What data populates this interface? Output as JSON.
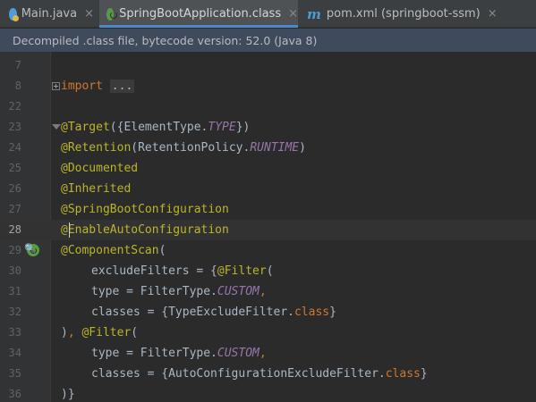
{
  "tabs": [
    {
      "label": "Main.java",
      "icon": "java-class-icon",
      "active": false
    },
    {
      "label": "SpringBootApplication.class",
      "icon": "spring-icon",
      "active": true
    },
    {
      "label": "pom.xml (springboot-ssm)",
      "icon": "maven-icon",
      "active": false
    }
  ],
  "close_glyph": "×",
  "banner": "Decompiled .class file, bytecode version: 52.0 (Java 8)",
  "lines": {
    "l7": {
      "num": "7"
    },
    "l8": {
      "num": "8",
      "kw": "import",
      "dots": "..."
    },
    "l22": {
      "num": "22"
    },
    "l23": {
      "num": "23",
      "ann": "@Target",
      "a": "({ElementType.",
      "it": "TYPE",
      "b": "})"
    },
    "l24": {
      "num": "24",
      "ann": "@Retention",
      "a": "(RetentionPolicy.",
      "it": "RUNTIME",
      "b": ")"
    },
    "l25": {
      "num": "25",
      "ann": "@Documented"
    },
    "l26": {
      "num": "26",
      "ann": "@Inherited"
    },
    "l27": {
      "num": "27",
      "ann": "@SpringBootConfiguration"
    },
    "l28": {
      "num": "28",
      "ann": "@EnableAutoConfiguration"
    },
    "l29": {
      "num": "29",
      "ann": "@ComponentScan",
      "a": "("
    },
    "l30": {
      "num": "30",
      "a": "excludeFilters = {",
      "ann": "@Filter",
      "b": "("
    },
    "l31": {
      "num": "31",
      "a": "type = FilterType.",
      "it": "CUSTOM",
      "kw": ","
    },
    "l32": {
      "num": "32",
      "a": "classes = {TypeExcludeFilter.",
      "kw": "class",
      "b": "}"
    },
    "l33": {
      "num": "33",
      "a": ")",
      "kw": ", ",
      "ann": "@Filter",
      "b": "("
    },
    "l34": {
      "num": "34",
      "a": "type = FilterType.",
      "it": "CUSTOM",
      "kw": ","
    },
    "l35": {
      "num": "35",
      "a": "classes = {AutoConfigurationExcludeFilter.",
      "kw": "class",
      "b": "}"
    },
    "l36": {
      "num": "36",
      "a": ")}"
    }
  },
  "colors": {
    "keyword": "#cc7832",
    "annotation": "#bbb529",
    "constant": "#9876aa",
    "text": "#a9b7c6",
    "banner": "#3f4a5c",
    "active_tab_underline": "#4a88c7"
  }
}
